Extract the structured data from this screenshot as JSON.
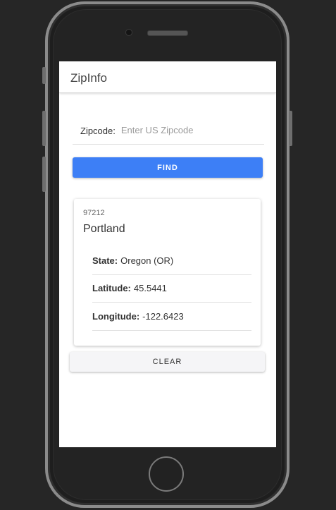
{
  "app": {
    "title": "ZipInfo"
  },
  "form": {
    "zipcode_label": "Zipcode:",
    "zipcode_placeholder": "Enter US Zipcode",
    "zipcode_value": "",
    "find_label": "FIND"
  },
  "result": {
    "zip": "97212",
    "city": "Portland",
    "details": [
      {
        "key": "State:",
        "value": "Oregon (OR)"
      },
      {
        "key": "Latitude:",
        "value": "45.5441"
      },
      {
        "key": "Longitude:",
        "value": "-122.6423"
      }
    ]
  },
  "actions": {
    "clear_label": "CLEAR"
  },
  "colors": {
    "primary": "#3d7ff6",
    "background": "#262626",
    "screen": "#ffffff"
  }
}
